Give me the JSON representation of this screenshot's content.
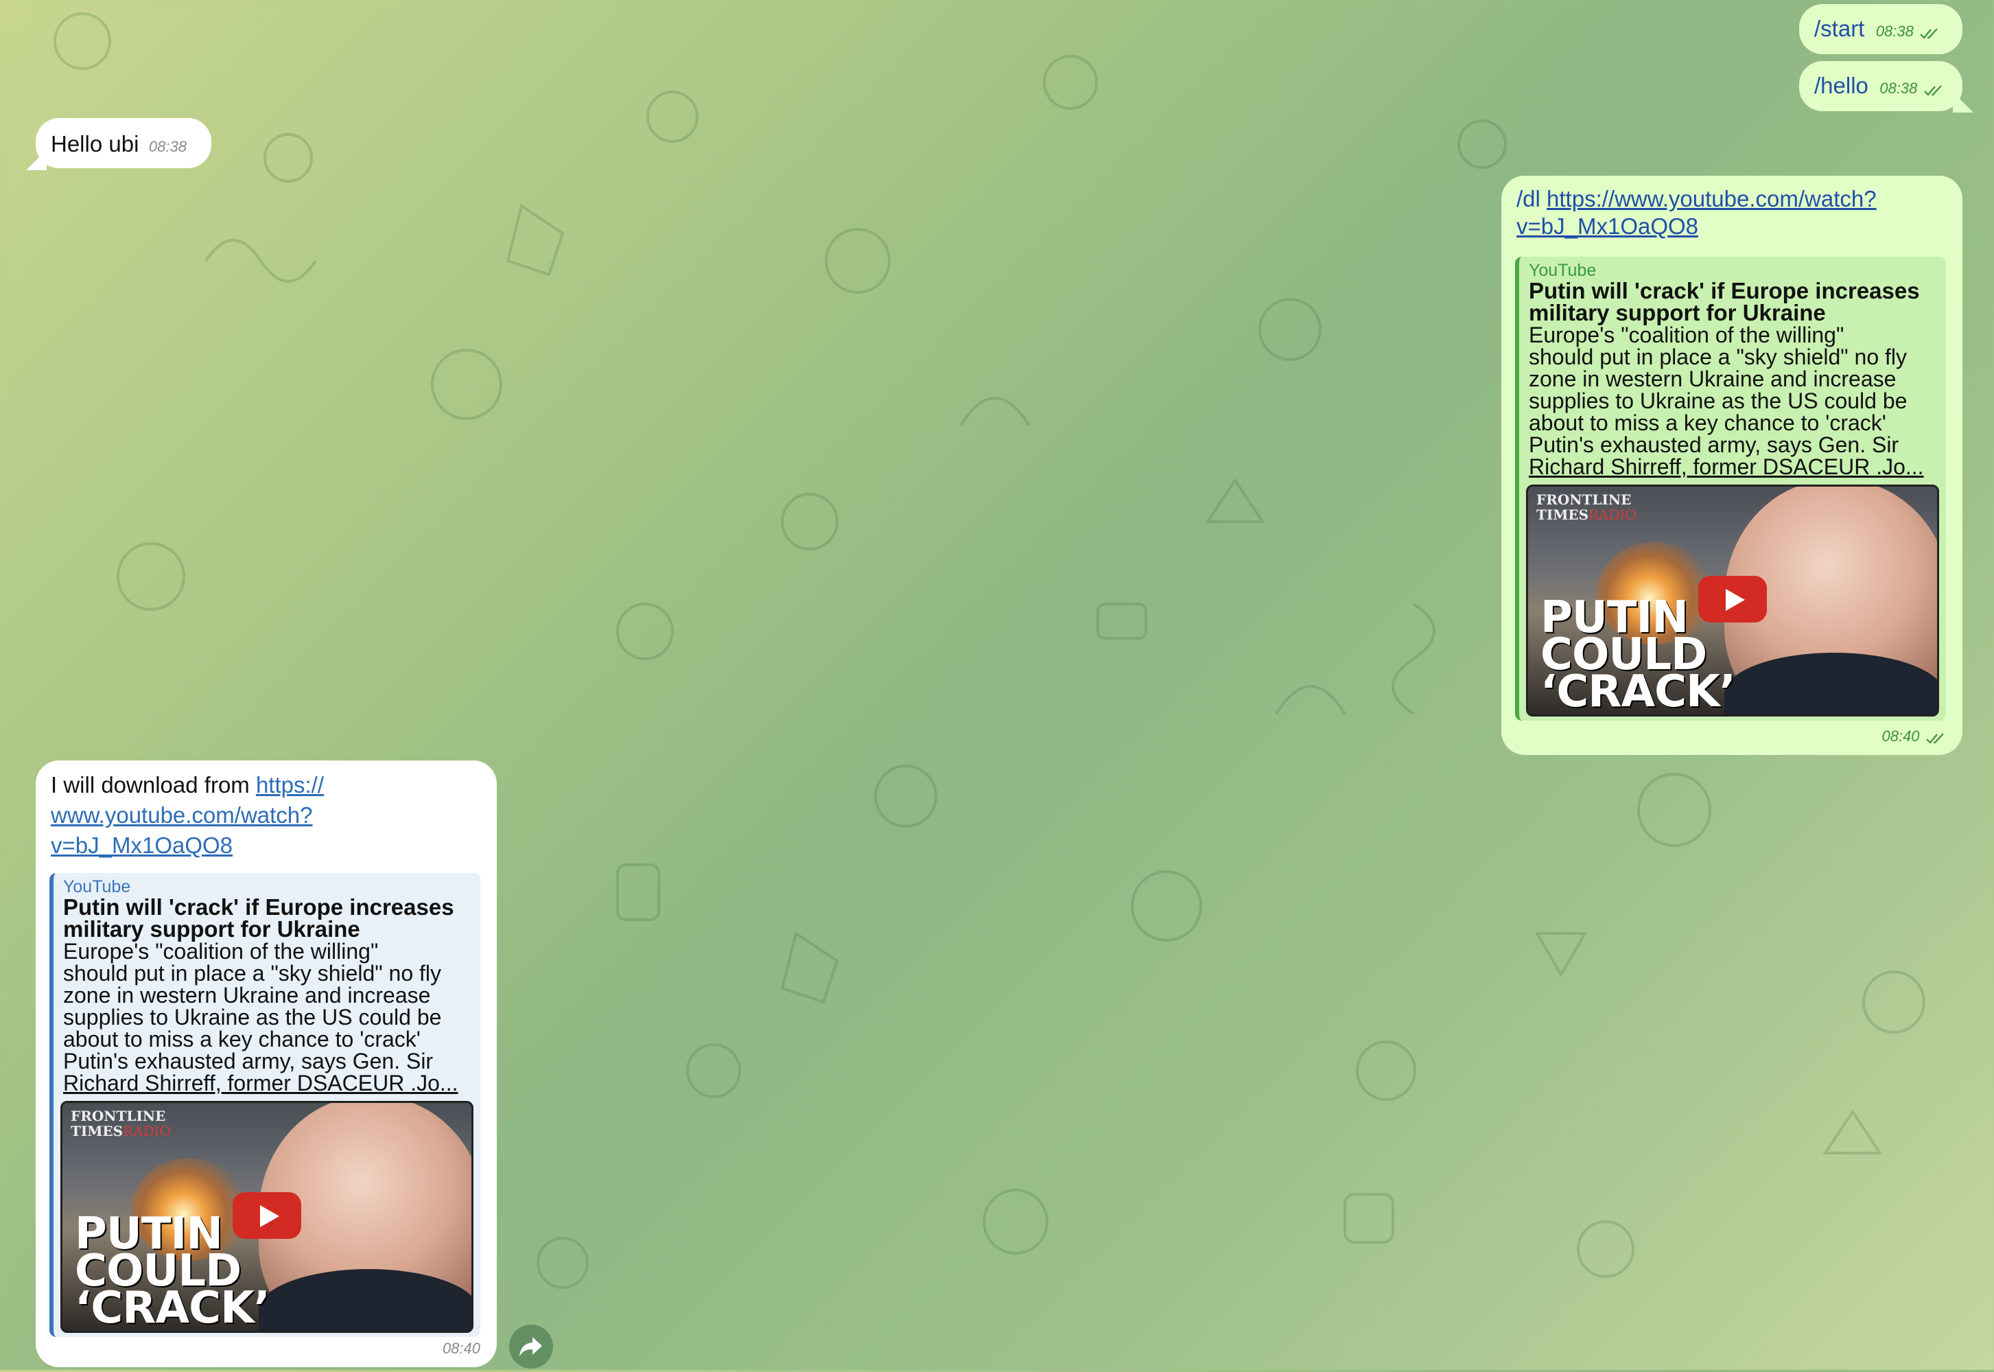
{
  "colors": {
    "outgoing_bubble": "#e1fec6",
    "incoming_bubble": "#ffffff",
    "link": "#2c6cb6",
    "youtube_play": "#d42a24",
    "time_outgoing": "#3e8f3e"
  },
  "messages": [
    {
      "dir": "out",
      "text": "/start",
      "time": "08:38",
      "status": "read"
    },
    {
      "dir": "out",
      "text": "/hello",
      "time": "08:38",
      "status": "read"
    },
    {
      "dir": "in",
      "text": "Hello ubi",
      "time": "08:38"
    },
    {
      "dir": "out",
      "prefix": "/dl",
      "link_line1": "https://www.youtube.com/watch?",
      "link_line2": "v=bJ_Mx1OaQO8",
      "time": "08:40",
      "status": "read"
    },
    {
      "dir": "in",
      "text_prefix": "I will download from",
      "link_line1": "https://",
      "link_line2": "www.youtube.com/watch?",
      "link_line3": "v=bJ_Mx1OaQO8",
      "time": "08:40"
    }
  ],
  "link_preview": {
    "site": "YouTube",
    "title_line1": "Putin will 'crack' if Europe increases",
    "title_line2": "military support for Ukraine",
    "desc_lines": [
      "Europe's \"coalition of the willing\"",
      "should put in place a \"sky shield\" no fly",
      "zone in western Ukraine and increase",
      "supplies to Ukraine as the US could be",
      "about to miss a key chance to 'crack'",
      "Putin's exhausted army, says Gen. Sir",
      "Richard Shirreff, former DSACEUR .Jo..."
    ],
    "thumbnail": {
      "brand_line1": "FRONTLINE",
      "brand_line2": "TIMES",
      "brand_radio": "RADIO",
      "headline_line1": "PUTIN",
      "headline_line2": "COULD",
      "headline_line3": "‘CRACK’",
      "icon": "play-icon"
    }
  },
  "actions": {
    "share_icon": "share-icon"
  }
}
